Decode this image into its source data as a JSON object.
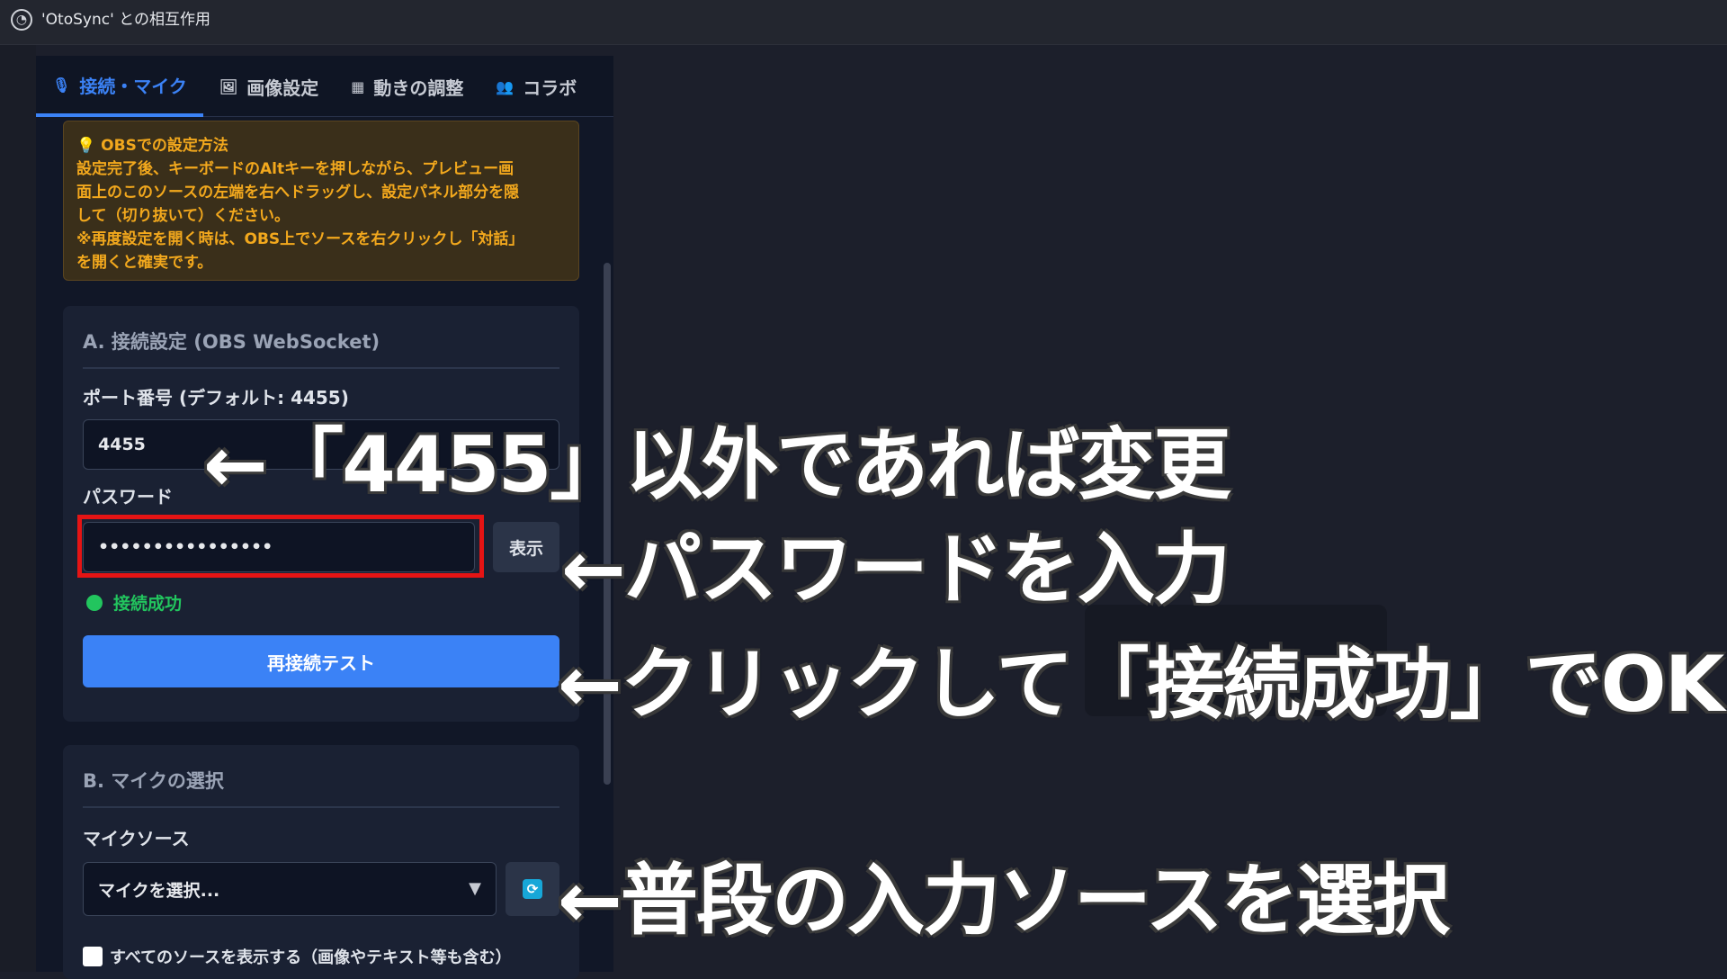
{
  "window": {
    "title": "'OtoSync' との相互作用",
    "app_icon": "obs-icon"
  },
  "tabs": [
    {
      "label": "接続・マイク",
      "icon": "microphone-icon",
      "active": true
    },
    {
      "label": "画像設定",
      "icon": "image-icon",
      "active": false
    },
    {
      "label": "動きの調整",
      "icon": "motion-icon",
      "active": false
    },
    {
      "label": "コラボ",
      "icon": "people-icon",
      "active": false
    }
  ],
  "obs_info": {
    "heading": "OBSでの設定方法",
    "line1": "設定完了後、キーボードのAltキーを押しながら、プレビュー画",
    "line2": "面上のこのソースの左端を右へドラッグし、設定パネル部分を隠",
    "line3": "して（切り抜いて）ください。",
    "line4": "※再度設定を開く時は、OBS上でソースを右クリックし「対話」",
    "line5": "を開くと確実です。"
  },
  "section_a": {
    "title": "A. 接続設定 (OBS WebSocket)",
    "port_label": "ポート番号 (デフォルト: 4455)",
    "port_value": "4455",
    "password_label": "パスワード",
    "password_value": "••••••••••••••••",
    "show_button": "表示",
    "status_text": "接続成功",
    "status_color": "#22c55e",
    "retest_button": "再接続テスト"
  },
  "section_b": {
    "title": "B. マイクの選択",
    "source_label": "マイクソース",
    "source_selected": "マイクを選択...",
    "refresh_icon": "refresh-icon",
    "show_all_label": "すべてのソースを表示する（画像やテキスト等も含む）"
  },
  "annotations": {
    "port": "←「4455」以外であれば変更",
    "password": "←パスワードを入力",
    "retest": "←クリックして「接続成功」でOK",
    "mic": "←普段の入力ソースを選択"
  },
  "colors": {
    "accent": "#3b82f6",
    "warning": "#f2a81d",
    "highlight": "#e51414"
  }
}
